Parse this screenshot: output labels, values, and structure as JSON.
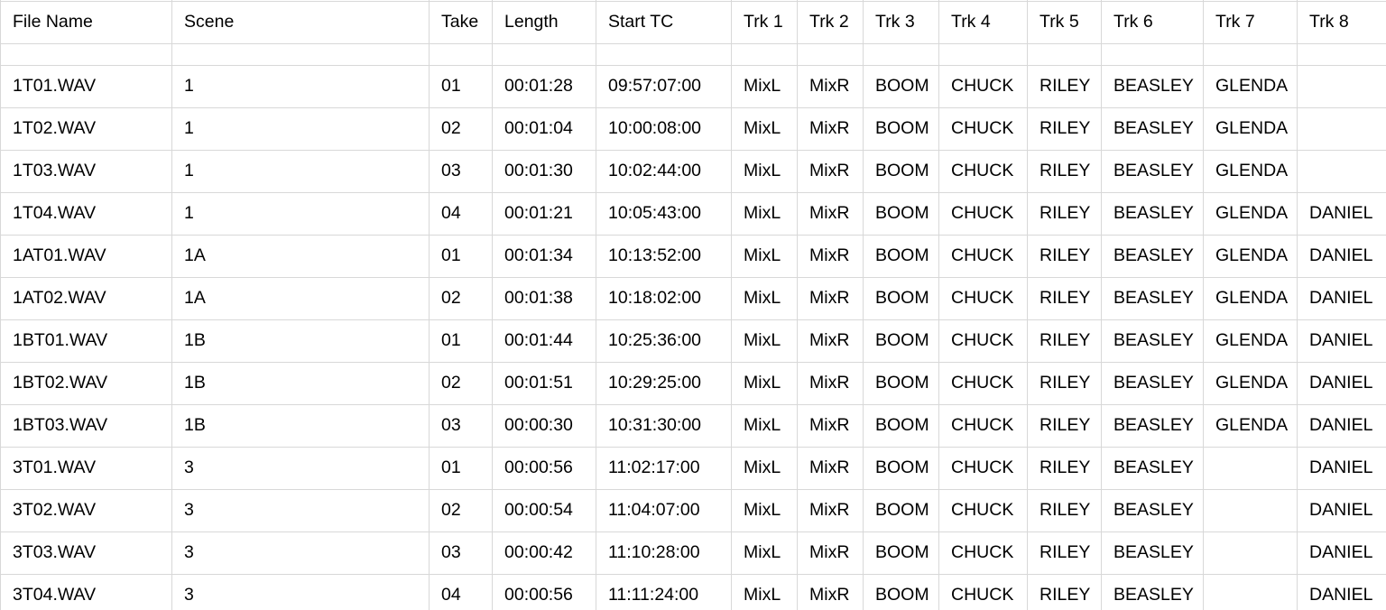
{
  "table": {
    "columns": [
      {
        "key": "file_name",
        "label": "File Name"
      },
      {
        "key": "scene",
        "label": "Scene"
      },
      {
        "key": "take",
        "label": "Take"
      },
      {
        "key": "length",
        "label": "Length"
      },
      {
        "key": "start_tc",
        "label": "Start TC"
      },
      {
        "key": "trk1",
        "label": "Trk 1"
      },
      {
        "key": "trk2",
        "label": "Trk 2"
      },
      {
        "key": "trk3",
        "label": "Trk 3"
      },
      {
        "key": "trk4",
        "label": "Trk 4"
      },
      {
        "key": "trk5",
        "label": "Trk 5"
      },
      {
        "key": "trk6",
        "label": "Trk 6"
      },
      {
        "key": "trk7",
        "label": "Trk 7"
      },
      {
        "key": "trk8",
        "label": "Trk 8"
      }
    ],
    "rows": [
      {
        "file_name": "1T01.WAV",
        "scene": "1",
        "take": "01",
        "length": "00:01:28",
        "start_tc": "09:57:07:00",
        "trk1": "MixL",
        "trk2": "MixR",
        "trk3": "BOOM",
        "trk4": "CHUCK",
        "trk5": "RILEY",
        "trk6": "BEASLEY",
        "trk7": "GLENDA",
        "trk8": ""
      },
      {
        "file_name": "1T02.WAV",
        "scene": "1",
        "take": "02",
        "length": "00:01:04",
        "start_tc": "10:00:08:00",
        "trk1": "MixL",
        "trk2": "MixR",
        "trk3": "BOOM",
        "trk4": "CHUCK",
        "trk5": "RILEY",
        "trk6": "BEASLEY",
        "trk7": "GLENDA",
        "trk8": ""
      },
      {
        "file_name": "1T03.WAV",
        "scene": "1",
        "take": "03",
        "length": "00:01:30",
        "start_tc": "10:02:44:00",
        "trk1": "MixL",
        "trk2": "MixR",
        "trk3": "BOOM",
        "trk4": "CHUCK",
        "trk5": "RILEY",
        "trk6": "BEASLEY",
        "trk7": "GLENDA",
        "trk8": ""
      },
      {
        "file_name": "1T04.WAV",
        "scene": "1",
        "take": "04",
        "length": "00:01:21",
        "start_tc": "10:05:43:00",
        "trk1": "MixL",
        "trk2": "MixR",
        "trk3": "BOOM",
        "trk4": "CHUCK",
        "trk5": "RILEY",
        "trk6": "BEASLEY",
        "trk7": "GLENDA",
        "trk8": "DANIEL"
      },
      {
        "file_name": "1AT01.WAV",
        "scene": "1A",
        "take": "01",
        "length": "00:01:34",
        "start_tc": "10:13:52:00",
        "trk1": "MixL",
        "trk2": "MixR",
        "trk3": "BOOM",
        "trk4": "CHUCK",
        "trk5": "RILEY",
        "trk6": "BEASLEY",
        "trk7": "GLENDA",
        "trk8": "DANIEL"
      },
      {
        "file_name": "1AT02.WAV",
        "scene": "1A",
        "take": "02",
        "length": "00:01:38",
        "start_tc": "10:18:02:00",
        "trk1": "MixL",
        "trk2": "MixR",
        "trk3": "BOOM",
        "trk4": "CHUCK",
        "trk5": "RILEY",
        "trk6": "BEASLEY",
        "trk7": "GLENDA",
        "trk8": "DANIEL"
      },
      {
        "file_name": "1BT01.WAV",
        "scene": "1B",
        "take": "01",
        "length": "00:01:44",
        "start_tc": "10:25:36:00",
        "trk1": "MixL",
        "trk2": "MixR",
        "trk3": "BOOM",
        "trk4": "CHUCK",
        "trk5": "RILEY",
        "trk6": "BEASLEY",
        "trk7": "GLENDA",
        "trk8": "DANIEL"
      },
      {
        "file_name": "1BT02.WAV",
        "scene": "1B",
        "take": "02",
        "length": "00:01:51",
        "start_tc": "10:29:25:00",
        "trk1": "MixL",
        "trk2": "MixR",
        "trk3": "BOOM",
        "trk4": "CHUCK",
        "trk5": "RILEY",
        "trk6": "BEASLEY",
        "trk7": "GLENDA",
        "trk8": "DANIEL"
      },
      {
        "file_name": "1BT03.WAV",
        "scene": "1B",
        "take": "03",
        "length": "00:00:30",
        "start_tc": "10:31:30:00",
        "trk1": "MixL",
        "trk2": "MixR",
        "trk3": "BOOM",
        "trk4": "CHUCK",
        "trk5": "RILEY",
        "trk6": "BEASLEY",
        "trk7": "GLENDA",
        "trk8": "DANIEL"
      },
      {
        "file_name": "3T01.WAV",
        "scene": "3",
        "take": "01",
        "length": "00:00:56",
        "start_tc": "11:02:17:00",
        "trk1": "MixL",
        "trk2": "MixR",
        "trk3": "BOOM",
        "trk4": "CHUCK",
        "trk5": "RILEY",
        "trk6": "BEASLEY",
        "trk7": "",
        "trk8": "DANIEL"
      },
      {
        "file_name": "3T02.WAV",
        "scene": "3",
        "take": "02",
        "length": "00:00:54",
        "start_tc": "11:04:07:00",
        "trk1": "MixL",
        "trk2": "MixR",
        "trk3": "BOOM",
        "trk4": "CHUCK",
        "trk5": "RILEY",
        "trk6": "BEASLEY",
        "trk7": "",
        "trk8": "DANIEL"
      },
      {
        "file_name": "3T03.WAV",
        "scene": "3",
        "take": "03",
        "length": "00:00:42",
        "start_tc": "11:10:28:00",
        "trk1": "MixL",
        "trk2": "MixR",
        "trk3": "BOOM",
        "trk4": "CHUCK",
        "trk5": "RILEY",
        "trk6": "BEASLEY",
        "trk7": "",
        "trk8": "DANIEL"
      },
      {
        "file_name": "3T04.WAV",
        "scene": "3",
        "take": "04",
        "length": "00:00:56",
        "start_tc": "11:11:24:00",
        "trk1": "MixL",
        "trk2": "MixR",
        "trk3": "BOOM",
        "trk4": "CHUCK",
        "trk5": "RILEY",
        "trk6": "BEASLEY",
        "trk7": "",
        "trk8": "DANIEL"
      }
    ]
  },
  "colors": {
    "grid_line": "#d8d8d8",
    "text": "#000000",
    "background": "#ffffff"
  }
}
